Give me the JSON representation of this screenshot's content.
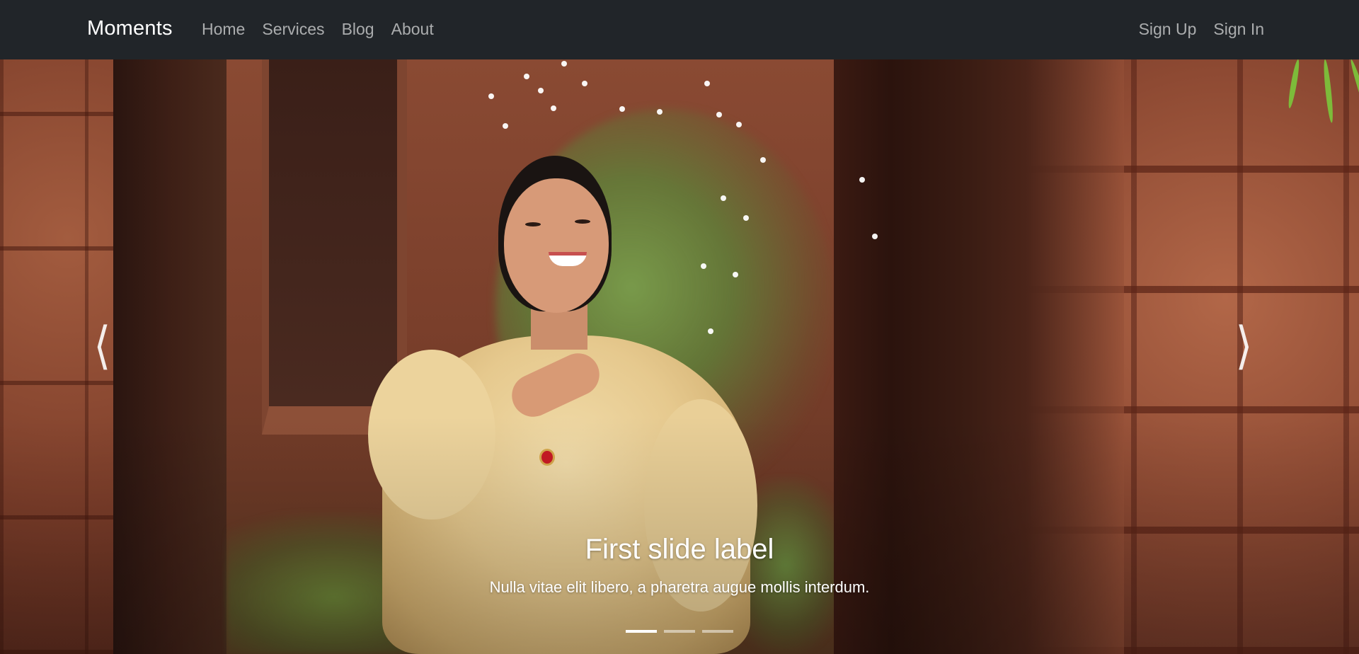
{
  "navbar": {
    "brand": "Moments",
    "links": [
      {
        "label": "Home"
      },
      {
        "label": "Services"
      },
      {
        "label": "Blog"
      },
      {
        "label": "About"
      }
    ],
    "auth": [
      {
        "label": "Sign Up"
      },
      {
        "label": "Sign In"
      }
    ]
  },
  "carousel": {
    "slide": {
      "title": "First slide label",
      "text": "Nulla vitae elit libero, a pharetra augue mollis interdum."
    },
    "prev_icon": "chevron-left-icon",
    "next_icon": "chevron-right-icon",
    "indicator_count": 3,
    "active_indicator": 1
  },
  "colors": {
    "navbar_bg": "#212529",
    "nav_link": "rgba(255,255,255,0.62)",
    "brand": "#ffffff"
  }
}
